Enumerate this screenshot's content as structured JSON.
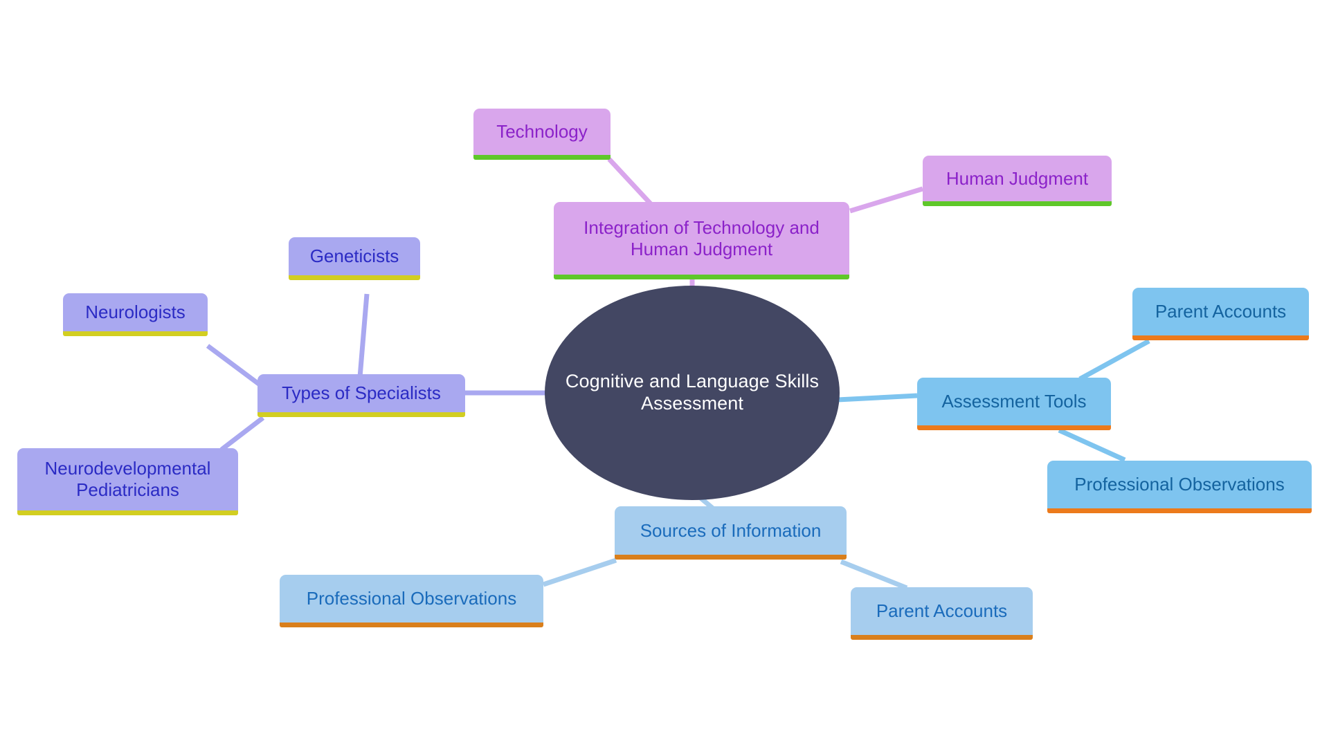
{
  "diagram": {
    "title": "Cognitive and Language Skills Assessment",
    "type": "mind-map",
    "background_color": "#ffffff"
  },
  "root": {
    "label": "Cognitive and Language Skills\nAssessment",
    "fill": "#434763",
    "text_color": "#ffffff"
  },
  "branches": [
    {
      "id": "types-of-specialists",
      "label": "Types of Specialists",
      "style": "lilac",
      "fill": "#a9a8f0",
      "text_color": "#2b2bc4",
      "underline_color": "#d2ce21",
      "children": [
        {
          "id": "neurologists",
          "label": "Neurologists"
        },
        {
          "id": "geneticists",
          "label": "Geneticists"
        },
        {
          "id": "neurodevelopmental-pediatricians",
          "label": "Neurodevelopmental\nPediatricians"
        }
      ]
    },
    {
      "id": "integration-of-technology-and-human-judgment",
      "label": "Integration of Technology and\nHuman Judgment",
      "style": "orchid",
      "fill": "#d9a6ec",
      "text_color": "#8b22c9",
      "underline_color": "#5fc72a",
      "children": [
        {
          "id": "technology",
          "label": "Technology"
        },
        {
          "id": "human-judgment",
          "label": "Human Judgment"
        }
      ]
    },
    {
      "id": "assessment-tools",
      "label": "Assessment Tools",
      "style": "skyblue",
      "fill": "#7ec4ef",
      "text_color": "#14639f",
      "underline_color": "#ec7a1b",
      "children": [
        {
          "id": "parent-accounts-right",
          "label": "Parent Accounts"
        },
        {
          "id": "professional-observations-right",
          "label": "Professional Observations"
        }
      ]
    },
    {
      "id": "sources-of-information",
      "label": "Sources of Information",
      "style": "lightblue",
      "fill": "#a6cdee",
      "text_color": "#1a6bbb",
      "underline_color": "#d97f1c",
      "children": [
        {
          "id": "professional-observations-bottom",
          "label": "Professional Observations"
        },
        {
          "id": "parent-accounts-bottom",
          "label": "Parent Accounts"
        }
      ]
    }
  ],
  "nodes": {
    "root": "Cognitive and Language Skills\nAssessment",
    "types_of_specialists": "Types of Specialists",
    "neurologists": "Neurologists",
    "geneticists": "Geneticists",
    "neurodevelopmental_pediatricians": "Neurodevelopmental\nPediatricians",
    "integration": "Integration of Technology and\nHuman Judgment",
    "technology": "Technology",
    "human_judgment": "Human Judgment",
    "assessment_tools": "Assessment Tools",
    "parent_accounts_right": "Parent Accounts",
    "professional_observations_right": "Professional Observations",
    "sources_of_information": "Sources of Information",
    "professional_observations_bottom": "Professional Observations",
    "parent_accounts_bottom": "Parent Accounts"
  },
  "edges": [
    {
      "from": "root",
      "to": "types_of_specialists",
      "color": "#a9a8f0"
    },
    {
      "from": "types_of_specialists",
      "to": "neurologists",
      "color": "#a9a8f0"
    },
    {
      "from": "types_of_specialists",
      "to": "geneticists",
      "color": "#a9a8f0"
    },
    {
      "from": "types_of_specialists",
      "to": "neurodevelopmental_pediatricians",
      "color": "#a9a8f0"
    },
    {
      "from": "root",
      "to": "integration",
      "color": "#d9a6ec"
    },
    {
      "from": "integration",
      "to": "technology",
      "color": "#d9a6ec"
    },
    {
      "from": "integration",
      "to": "human_judgment",
      "color": "#d9a6ec"
    },
    {
      "from": "root",
      "to": "assessment_tools",
      "color": "#7ec4ef"
    },
    {
      "from": "assessment_tools",
      "to": "parent_accounts_right",
      "color": "#7ec4ef"
    },
    {
      "from": "assessment_tools",
      "to": "professional_observations_right",
      "color": "#7ec4ef"
    },
    {
      "from": "root",
      "to": "sources_of_information",
      "color": "#a6cdee"
    },
    {
      "from": "sources_of_information",
      "to": "professional_observations_bottom",
      "color": "#a6cdee"
    },
    {
      "from": "sources_of_information",
      "to": "parent_accounts_bottom",
      "color": "#a6cdee"
    }
  ]
}
